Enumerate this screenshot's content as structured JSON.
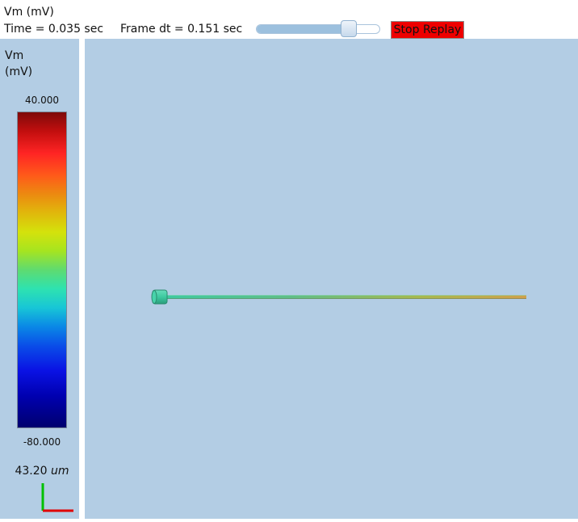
{
  "header": {
    "title": "Vm (mV)",
    "time_text": "Time = 0.035 sec",
    "frame_dt_text": "Frame dt = 0.151 sec",
    "slider": {
      "position_fraction": 0.75
    },
    "stop_button_label": "Stop Replay",
    "stop_button_color": "#ee0000"
  },
  "colorbar": {
    "label_line1": "Vm",
    "label_line2": "(mV)",
    "max_label": "40.000",
    "min_label": "-80.000",
    "scale_value": "43.20 ",
    "scale_unit": "um",
    "axis_x_color": "#e00000",
    "axis_y_color": "#00c000"
  },
  "viewport": {
    "background": "#b3cde4",
    "soma_color": "#3ec9a0",
    "dendrite_gradient": [
      "#3ec9a0",
      "#5fbe86",
      "#a6b84e",
      "#cfa04a"
    ],
    "icons": [
      "soma-icon",
      "dendrite-icon"
    ]
  }
}
